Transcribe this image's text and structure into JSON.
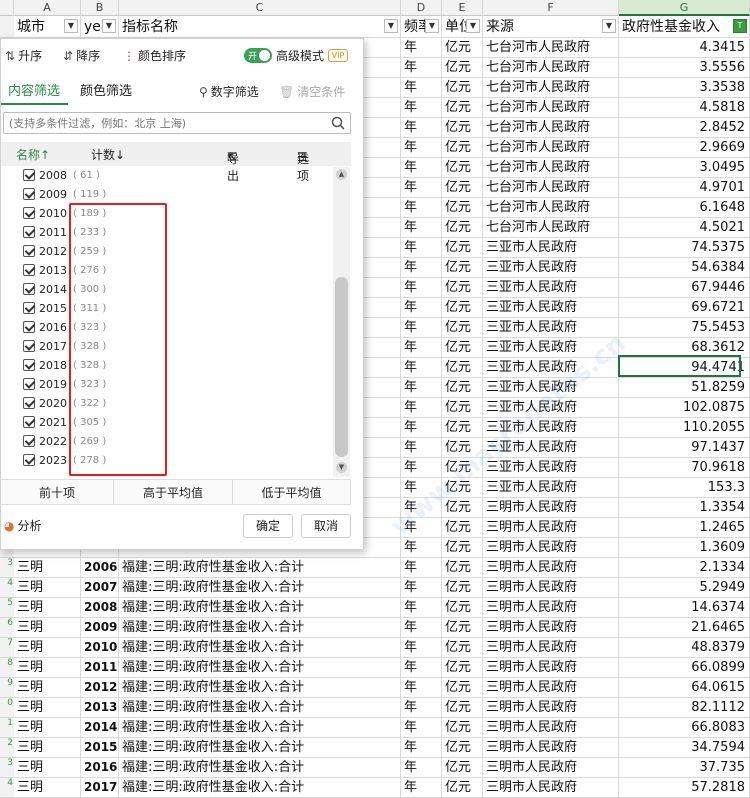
{
  "columns": [
    "A",
    "B",
    "C",
    "D",
    "E",
    "F",
    "G"
  ],
  "header": [
    "城市",
    "yea",
    "指标名称",
    "频率",
    "单位",
    "来源",
    "政府性基金收入"
  ],
  "top_rows": [
    {
      "source": "七台河市人民政府",
      "value": "4.3415"
    },
    {
      "source": "七台河市人民政府",
      "value": "3.5556"
    },
    {
      "source": "七台河市人民政府",
      "value": "3.3538"
    },
    {
      "source": "七台河市人民政府",
      "value": "4.5818"
    },
    {
      "source": "七台河市人民政府",
      "value": "2.8452"
    },
    {
      "source": "七台河市人民政府",
      "value": "2.9669"
    },
    {
      "source": "七台河市人民政府",
      "value": "3.0495"
    },
    {
      "source": "七台河市人民政府",
      "value": "4.9701"
    },
    {
      "source": "七台河市人民政府",
      "value": "6.1648"
    },
    {
      "source": "七台河市人民政府",
      "value": "4.5021"
    },
    {
      "source": "三亚市人民政府",
      "value": "74.5375"
    },
    {
      "source": "三亚市人民政府",
      "value": "54.6384"
    },
    {
      "source": "三亚市人民政府",
      "value": "67.9446"
    },
    {
      "source": "三亚市人民政府",
      "value": "69.6721"
    },
    {
      "source": "三亚市人民政府",
      "value": "75.5453"
    },
    {
      "source": "三亚市人民政府",
      "value": "68.3612"
    },
    {
      "source": "三亚市人民政府",
      "value": "94.4741"
    },
    {
      "source": "三亚市人民政府",
      "value": "51.8259"
    },
    {
      "source": "三亚市人民政府",
      "value": "102.0875"
    },
    {
      "source": "三亚市人民政府",
      "value": "110.2055"
    },
    {
      "source": "三亚市人民政府",
      "value": "97.1437"
    },
    {
      "source": "三亚市人民政府",
      "value": "70.9618"
    },
    {
      "source": "三亚市人民政府",
      "value": "153.3"
    },
    {
      "source": "三明市人民政府",
      "value": "1.3354"
    },
    {
      "source": "三明市人民政府",
      "value": "1.2465"
    },
    {
      "source": "三明市人民政府",
      "value": "1.3609"
    }
  ],
  "full_rows": [
    {
      "rn": "3",
      "city": "三明",
      "year": "2006",
      "ind": "福建:三明:政府性基金收入:合计",
      "source": "三明市人民政府",
      "value": "2.1334"
    },
    {
      "rn": "4",
      "city": "三明",
      "year": "2007",
      "ind": "福建:三明:政府性基金收入:合计",
      "source": "三明市人民政府",
      "value": "5.2949"
    },
    {
      "rn": "5",
      "city": "三明",
      "year": "2008",
      "ind": "福建:三明:政府性基金收入:合计",
      "source": "三明市人民政府",
      "value": "14.6374"
    },
    {
      "rn": "6",
      "city": "三明",
      "year": "2009",
      "ind": "福建:三明:政府性基金收入:合计",
      "source": "三明市人民政府",
      "value": "21.6465"
    },
    {
      "rn": "7",
      "city": "三明",
      "year": "2010",
      "ind": "福建:三明:政府性基金收入:合计",
      "source": "三明市人民政府",
      "value": "48.8379"
    },
    {
      "rn": "8",
      "city": "三明",
      "year": "2011",
      "ind": "福建:三明:政府性基金收入:合计",
      "source": "三明市人民政府",
      "value": "66.0899"
    },
    {
      "rn": "9",
      "city": "三明",
      "year": "2012",
      "ind": "福建:三明:政府性基金收入:合计",
      "source": "三明市人民政府",
      "value": "64.0615"
    },
    {
      "rn": "0",
      "city": "三明",
      "year": "2013",
      "ind": "福建:三明:政府性基金收入:合计",
      "source": "三明市人民政府",
      "value": "82.1112"
    },
    {
      "rn": "1",
      "city": "三明",
      "year": "2014",
      "ind": "福建:三明:政府性基金收入:合计",
      "source": "三明市人民政府",
      "value": "66.8083"
    },
    {
      "rn": "2",
      "city": "三明",
      "year": "2015",
      "ind": "福建:三明:政府性基金收入:合计",
      "source": "三明市人民政府",
      "value": "34.7594"
    },
    {
      "rn": "3",
      "city": "三明",
      "year": "2016",
      "ind": "福建:三明:政府性基金收入:合计",
      "source": "三明市人民政府",
      "value": "37.735"
    },
    {
      "rn": "4",
      "city": "三明",
      "year": "2017",
      "ind": "福建:三明:政府性基金收入:合计",
      "source": "三明市人民政府",
      "value": "57.2818"
    }
  ],
  "freq": "年",
  "unit": "亿元",
  "panel": {
    "sort_asc": "升序",
    "sort_desc": "降序",
    "color_sort": "颜色排序",
    "toggle_on": "开",
    "advanced": "高级模式",
    "vip": "VIP",
    "tab_content": "内容筛选",
    "tab_color": "颜色筛选",
    "num_filter": "数字筛选",
    "clear": "清空条件",
    "search_placeholder": "(支持多条件过滤，例如：北京 上海)",
    "col_name": "名称↑",
    "col_count": "计数↓",
    "export": "导出",
    "options": "选项",
    "items": [
      {
        "label": "2008",
        "count": "( 61 )"
      },
      {
        "label": "2009",
        "count": "( 119 )"
      },
      {
        "label": "2010",
        "count": "( 189 )"
      },
      {
        "label": "2011",
        "count": "( 233 )"
      },
      {
        "label": "2012",
        "count": "( 259 )"
      },
      {
        "label": "2013",
        "count": "( 276 )"
      },
      {
        "label": "2014",
        "count": "( 300 )"
      },
      {
        "label": "2015",
        "count": "( 311 )"
      },
      {
        "label": "2016",
        "count": "( 323 )"
      },
      {
        "label": "2017",
        "count": "( 328 )"
      },
      {
        "label": "2018",
        "count": "( 328 )"
      },
      {
        "label": "2019",
        "count": "( 323 )"
      },
      {
        "label": "2020",
        "count": "( 322 )"
      },
      {
        "label": "2021",
        "count": "( 305 )"
      },
      {
        "label": "2022",
        "count": "( 269 )"
      },
      {
        "label": "2023",
        "count": "( 278 )"
      }
    ],
    "top10": "前十项",
    "above_avg": "高于平均值",
    "below_avg": "低于平均值",
    "analysis": "分析",
    "ok": "确定",
    "cancel": "取消"
  }
}
